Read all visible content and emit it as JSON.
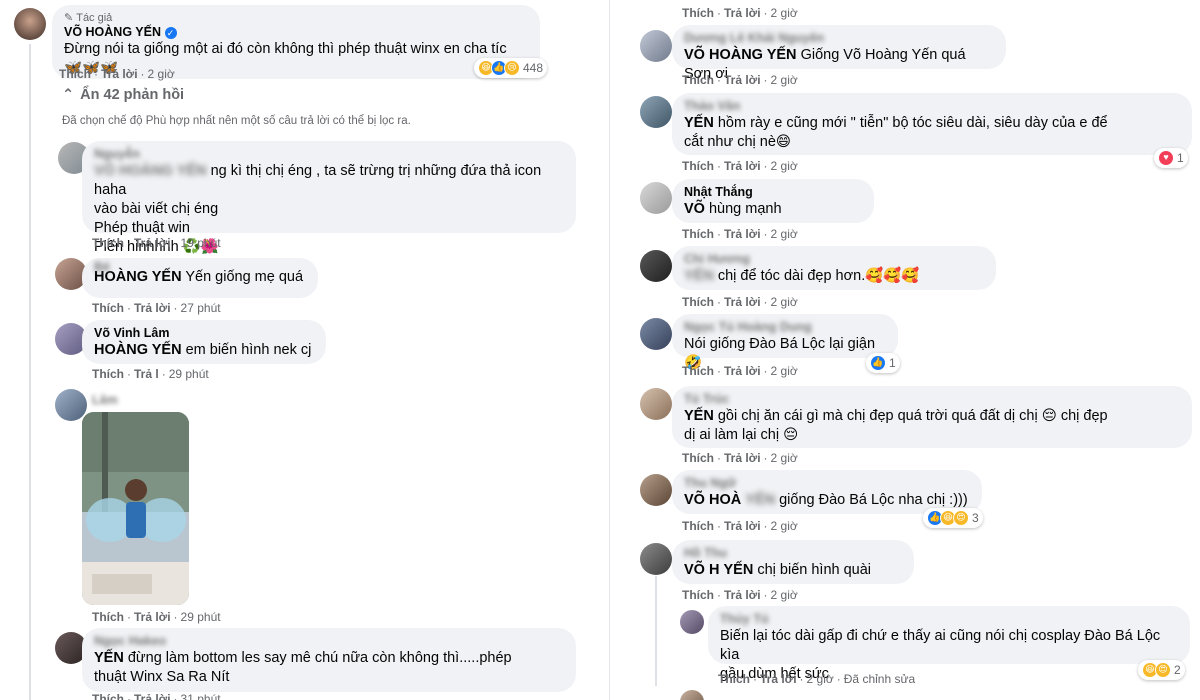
{
  "left": {
    "author_comment": {
      "author_badge": "Tác giả",
      "name": "VÕ HOÀNG YẾN",
      "text": "Đừng nói ta giống một ai đó còn không thì phép thuật winx en cha tíc 🦋🦋🦋",
      "reaction_count": "448",
      "like": "Thích",
      "reply": "Trả lời",
      "time": "2 giờ"
    },
    "replies_toggle": "Ẩn 42 phản hồi",
    "filter_note": "Đã chọn chế độ Phù hợp nhất nên một số câu trả lời có thể bị lọc ra.",
    "comments": [
      {
        "name": "Nguyễn",
        "line1_blur": "VÕ HOÀNG YẾN",
        "line1": "ng kì thị chị éng , ta sẽ trừng trị những đứa thả icon haha",
        "line2": "vào bài viết chị éng\nPhép thuật win\nPiến hinhhhh ♻️🌺",
        "like": "Thích",
        "reply": "Trả lời",
        "time": "19 phút"
      },
      {
        "name": "Bé",
        "tag": "HOÀNG YẾN",
        "text": "Yến giống mẹ quá",
        "like": "Thích",
        "reply": "Trả lời",
        "time": "27 phút"
      },
      {
        "name": "Võ Vinh Lâm",
        "tag": "HOÀNG YẾN",
        "text": "em biến hình nek cj",
        "like": "Thích",
        "reply": "Trả l",
        "time": "29 phút"
      },
      {
        "name": "Lâm",
        "like": "Thích",
        "reply": "Trả lời",
        "time": "29 phút"
      },
      {
        "name": "Ngọc Hakeo",
        "tag": "YẾN",
        "text": "đừng làm bottom les say mê chú nữa còn không thì.....phép\nthuật Winx Sa Ra Nít",
        "like": "Thích",
        "reply": "Trả lời",
        "time": "31 phút"
      }
    ]
  },
  "right": {
    "top_actions": {
      "like": "Thích",
      "reply": "Trả lời",
      "time": "2 giờ"
    },
    "comments": [
      {
        "name": "Dương Lê Khải Nguyên",
        "tag": "VÕ HOÀNG YẾN",
        "text": "Giống Võ Hoàng Yến quá Sơn ơi",
        "like": "Thích",
        "reply": "Trả lời",
        "time": "2 giờ"
      },
      {
        "name": "Thảo Vân",
        "tag": "YẾN",
        "text": "hồm rày e cũng mới \" tiễn\" bộ tóc siêu dài, siêu dày của e để\ncắt như chị nè😄",
        "like": "Thích",
        "reply": "Trả lời",
        "time": "2 giờ",
        "reaction_count": "1"
      },
      {
        "name": "Nhật Thắng",
        "tag": "VÕ",
        "text": "hùng mạnh",
        "like": "Thích",
        "reply": "Trả lời",
        "time": "2 giờ"
      },
      {
        "name": "Chi Hương",
        "tag": "YẾN",
        "text": "chị để tóc dài đẹp hơn.🥰🥰🥰",
        "like": "Thích",
        "reply": "Trả lời",
        "time": "2 giờ"
      },
      {
        "name": "Ngọc Tú Hoàng Dung",
        "text": "Nói giống Đào Bá Lộc lại giận 🤣",
        "like": "Thích",
        "reply": "Trả lời",
        "time": "2 giờ",
        "reaction_count": "1"
      },
      {
        "name": "Tú Trúc",
        "tag": "YẾN",
        "text": "gồi chị ăn cái gì mà chị đẹp quá trời quá đất dị chị 😔 chị đẹp\ndị ai làm lại chị 😔",
        "like": "Thích",
        "reply": "Trả lời",
        "time": "2 giờ"
      },
      {
        "name": "Thu Ngữ",
        "tag": "VÕ HOÀ",
        "tag2": "YẾN",
        "text": "giống Đào Bá Lộc nha chị :)))",
        "like": "Thích",
        "reply": "Trả lời",
        "time": "2 giờ",
        "reaction_count": "3"
      },
      {
        "name": "Hồ Thu",
        "tag": "VÕ H",
        "tag2": "YẾN",
        "text": "chị biến hình quài",
        "like": "Thích",
        "reply": "Trả lời",
        "time": "2 giờ"
      },
      {
        "name": "Thủy Tú",
        "text": "Biến lại tóc dài gấp đi chứ e thấy ai cũng nói chị cosplay Đào Bá Lộc kìa\ngầu dùm hết sức",
        "like": "Thích",
        "reply": "Trả lời",
        "time": "2 giờ",
        "edited": "Đã chỉnh sửa",
        "reaction_count": "2"
      }
    ]
  }
}
